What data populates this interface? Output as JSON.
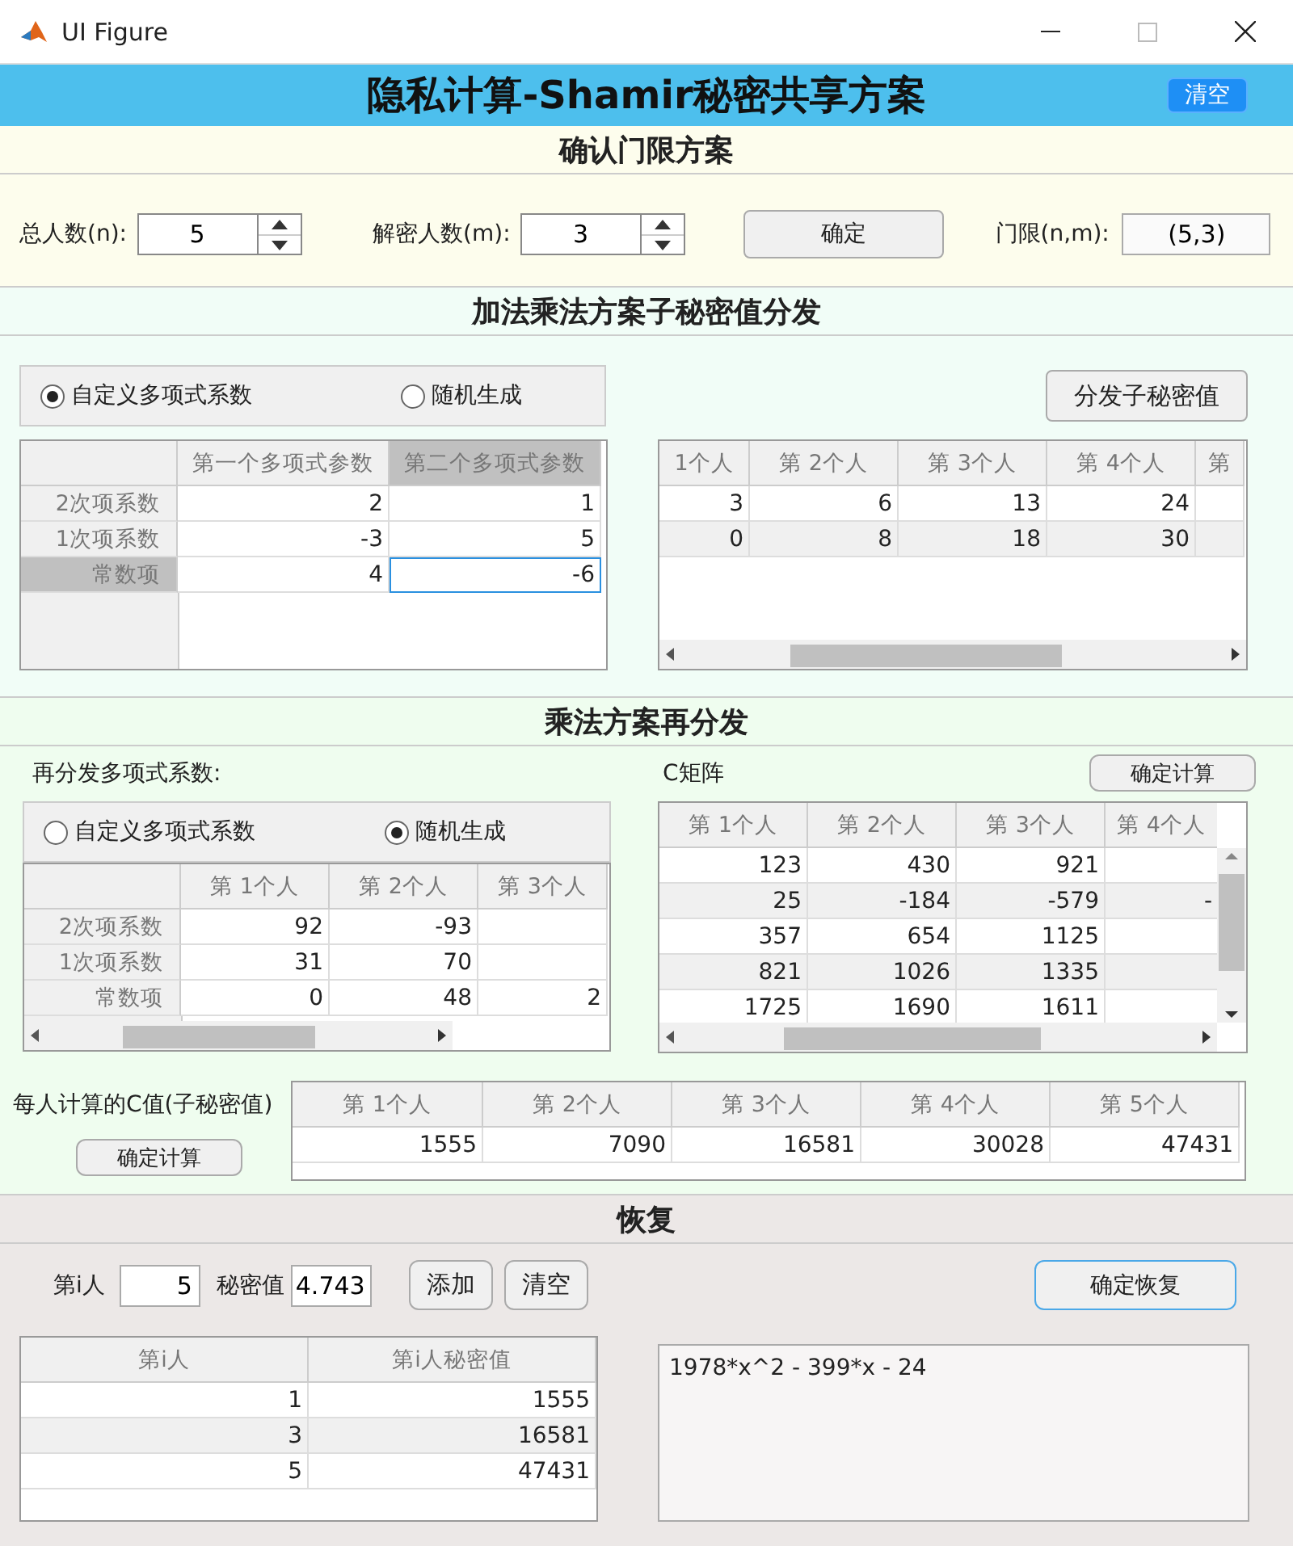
{
  "window": {
    "title": "UI Figure"
  },
  "header": {
    "title": "隐私计算-Shamir秘密共享方案",
    "clear_button": "清空"
  },
  "threshold": {
    "title": "确认门限方案",
    "fields": [
      {
        "label": "总人数(n):",
        "value": "5"
      },
      {
        "label": "解密人数(m):",
        "value": "3"
      }
    ],
    "confirm_button": "确定",
    "result": {
      "label": "门限(n,m):",
      "value": "(5,3)"
    }
  },
  "distribution": {
    "title": "加法乘法方案子秘密值分发",
    "radio": [
      {
        "label": "自定义多项式系数",
        "selected": true
      },
      {
        "label": "随机生成",
        "selected": false
      }
    ],
    "distribute_button": "分发子秘密值",
    "coefficients": {
      "columns": [
        {
          "label": "第一个多项式参数",
          "selected": false
        },
        {
          "label": "第二个多项式参数",
          "selected": true
        }
      ],
      "rows": [
        {
          "header": "2次项系数",
          "selected": false,
          "cells": [
            {
              "text": "2",
              "focused": false
            },
            {
              "text": "1",
              "focused": false
            }
          ]
        },
        {
          "header": "1次项系数",
          "selected": false,
          "cells": [
            {
              "text": "-3",
              "focused": false
            },
            {
              "text": "5",
              "focused": false
            }
          ]
        },
        {
          "header": "常数项",
          "selected": true,
          "cells": [
            {
              "text": "4",
              "focused": false
            },
            {
              "text": "-6",
              "focused": true
            }
          ]
        }
      ]
    },
    "shares": {
      "columns": [
        "1个人",
        "第  2个人",
        "第  3个人",
        "第  4个人",
        "第"
      ],
      "rows": [
        [
          "3",
          "6",
          "13",
          "24"
        ],
        [
          "0",
          "8",
          "18",
          "30"
        ]
      ]
    }
  },
  "redistribution": {
    "title": "乘法方案再分发",
    "coef_label": "再分发多项式系数:",
    "radio": [
      {
        "label": "自定义多项式系数",
        "selected": false
      },
      {
        "label": "随机生成",
        "selected": true
      }
    ],
    "coefficients": {
      "columns": [
        "第  1个人",
        "第  2个人",
        "第  3个人"
      ],
      "rows": [
        {
          "header": "2次项系数",
          "cells": [
            "92",
            "-93"
          ]
        },
        {
          "header": "1次项系数",
          "cells": [
            "31",
            "70"
          ]
        },
        {
          "header": "常数项",
          "cells": [
            "0",
            "48",
            "2"
          ]
        }
      ]
    },
    "matrix_label": "C矩阵",
    "compute_button": "确定计算",
    "c_matrix": {
      "columns": [
        "第  1个人",
        "第  2个人",
        "第  3个人",
        "第  4个人"
      ],
      "rows": [
        [
          "123",
          "430",
          "921"
        ],
        [
          "25",
          "-184",
          "-579",
          "-"
        ],
        [
          "357",
          "654",
          "1125"
        ],
        [
          "821",
          "1026",
          "1335"
        ],
        [
          "1725",
          "1690",
          "1611"
        ]
      ]
    },
    "c_values_label": "每人计算的C值(子秘密值)",
    "c_values_button": "确定计算",
    "c_values": {
      "columns": [
        "第  1个人",
        "第  2个人",
        "第  3个人",
        "第  4个人",
        "第  5个人"
      ],
      "rows": [
        [
          "1555",
          "7090",
          "16581",
          "30028",
          "47431"
        ]
      ]
    }
  },
  "recovery": {
    "title": "恢复",
    "index_label": "第i人",
    "index_value": "5",
    "secret_label": "秘密值",
    "secret_value": "4.743",
    "add_button": "添加",
    "clear_button": "清空",
    "recover_button": "确定恢复",
    "table": {
      "columns": [
        "第i人",
        "第i人秘密值"
      ],
      "rows": [
        [
          "1",
          "1555"
        ],
        [
          "3",
          "16581"
        ],
        [
          "5",
          "47431"
        ]
      ]
    },
    "result": "1978*x^2 - 399*x - 24"
  }
}
